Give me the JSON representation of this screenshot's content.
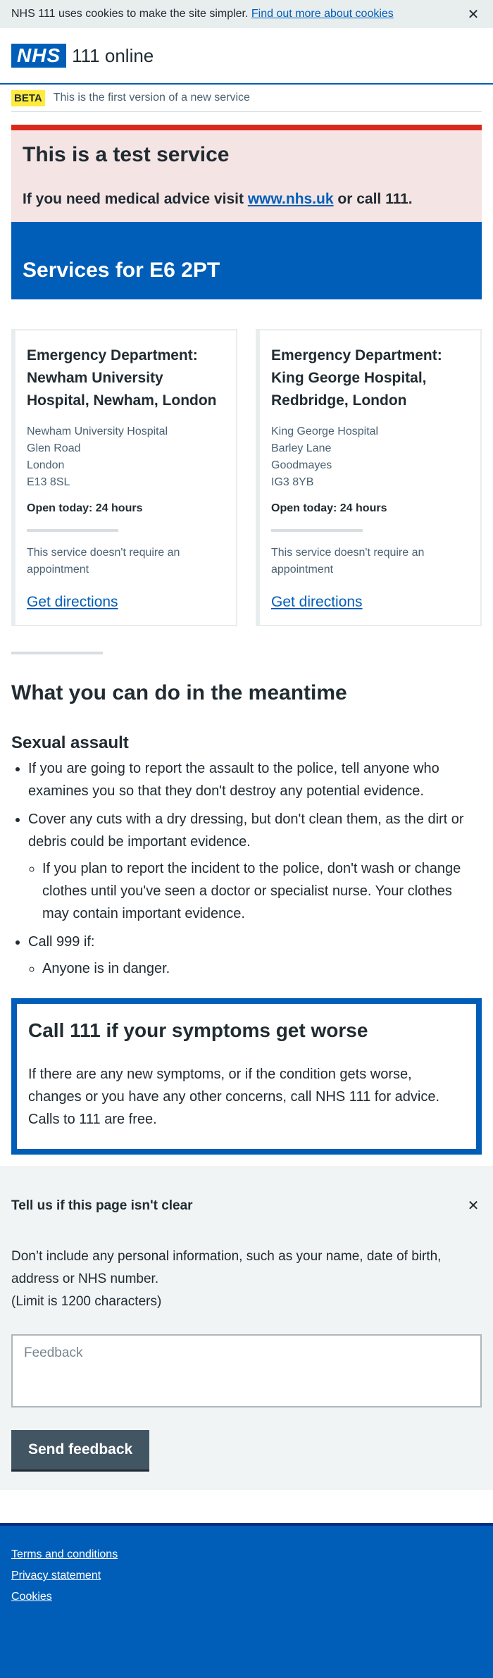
{
  "cookie_banner": {
    "text": "NHS 111 uses cookies to make the site simpler.",
    "link": "Find out more about cookies",
    "close": "✕"
  },
  "header": {
    "logo": "NHS",
    "service_name": "111 online"
  },
  "beta": {
    "tag": "BETA",
    "text": "This is the first version of a new service"
  },
  "test_service": {
    "title": "This is a test service",
    "prefix": "If you need medical advice visit",
    "link": "www.nhs.uk",
    "suffix": "or call 111."
  },
  "services": {
    "title": "Services for E6 2PT",
    "cards": [
      {
        "name": "Emergency Department: Newham University Hospital, Newham, London",
        "address": [
          "Newham University Hospital",
          "Glen Road",
          "London",
          "E13 8SL"
        ],
        "open": "Open today: 24 hours",
        "note": "This service doesn't require an appointment",
        "directions": "Get directions"
      },
      {
        "name": "Emergency Department: King George Hospital, Redbridge, London",
        "address": [
          "King George Hospital",
          "Barley Lane",
          "Goodmayes",
          "IG3 8YB"
        ],
        "open": "Open today: 24 hours",
        "note": "This service doesn't require an appointment",
        "directions": "Get directions"
      }
    ]
  },
  "meantime": {
    "title": "What you can do in the meantime",
    "subtitle": "Sexual assault",
    "items": [
      "If you are going to report the assault to the police, tell anyone who examines you so that they don't destroy any potential evidence.",
      "Cover any cuts with a dry dressing, but don't clean them, as the dirt or debris could be important evidence.",
      "If you plan to report the incident to the police, don't wash or change clothes until you've seen a doctor or specialist nurse. Your clothes may contain important evidence.",
      "Call 999 if:",
      "Anyone is in danger."
    ]
  },
  "care_card": {
    "title": "Call 111 if your symptoms get worse",
    "body": "If there are any new symptoms, or if the condition gets worse, changes or you have any other concerns, call NHS 111 for advice. Calls to 111 are free."
  },
  "feedback": {
    "title": "Tell us if this page isn't clear",
    "close": "✕",
    "body": "Don’t include any personal information, such as your name, date of birth, address or NHS number.",
    "limit": "(Limit is 1200 characters)",
    "placeholder": "Feedback",
    "button": "Send feedback"
  },
  "footer": {
    "links": [
      "Terms and conditions",
      "Privacy statement",
      "Cookies"
    ]
  },
  "colors": {
    "nhs_blue": "#005eb8",
    "red": "#da291c",
    "yellow": "#ffeb3b",
    "dark_blue": "#003087"
  }
}
